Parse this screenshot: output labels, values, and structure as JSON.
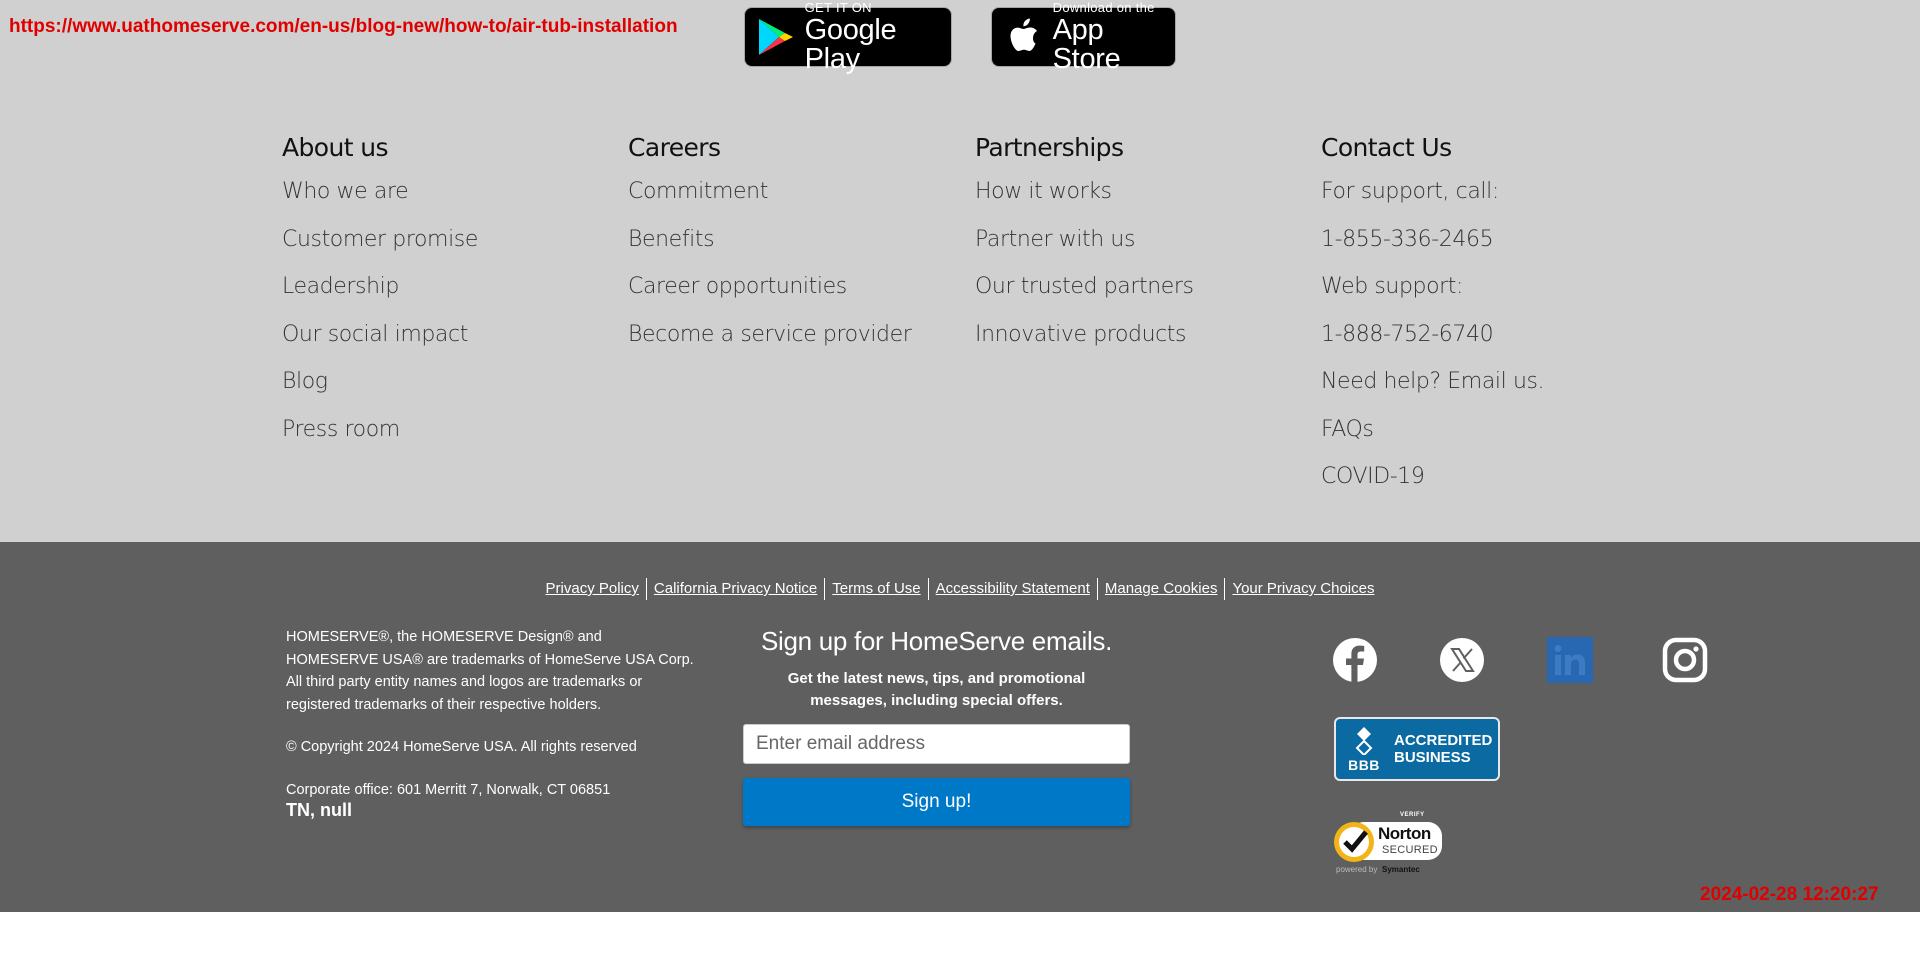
{
  "url_stamp": "https://www.uathomeserve.com/en-us/blog-new/how-to/air-tub-installation",
  "badges": {
    "google": {
      "small": "GET IT ON",
      "big": "Google Play"
    },
    "apple": {
      "small": "Download on the",
      "big": "App Store"
    }
  },
  "columns": {
    "about": {
      "title": "About us",
      "links": [
        "Who we are",
        "Customer promise",
        "Leadership",
        "Our social impact",
        "Blog",
        "Press room"
      ]
    },
    "careers": {
      "title": "Careers",
      "links": [
        "Commitment",
        "Benefits",
        "Career opportunities",
        "Become a service provider"
      ]
    },
    "partnerships": {
      "title": "Partnerships",
      "links": [
        "How it works",
        "Partner with us",
        "Our trusted partners",
        "Innovative products"
      ]
    },
    "contact": {
      "title": "Contact Us",
      "links": [
        "For support, call:",
        "1-855-336-2465",
        "Web support:",
        "1-888-752-6740",
        "Need help? Email us.",
        "FAQs",
        "COVID-19"
      ]
    }
  },
  "legal_links": [
    "Privacy Policy",
    "California Privacy Notice",
    "Terms of Use",
    "Accessibility Statement",
    "Manage Cookies",
    "Your Privacy Choices"
  ],
  "legal": {
    "trademark": "HOMESERVE®, the HOMESERVE Design® and HOMESERVE USA® are trademarks of HomeServe USA Corp. All third party entity names and logos are trademarks or registered trademarks of their respective holders.",
    "copyright": "© Copyright 2024 HomeServe USA. All rights reserved",
    "corporate": "Corporate office: 601 Merritt 7, Norwalk, CT 06851",
    "location": "TN, null"
  },
  "signup": {
    "title": "Sign up for HomeServe emails.",
    "subtitle": "Get the latest news, tips, and promotional messages, including special offers.",
    "placeholder": "Enter email address",
    "button": "Sign up!"
  },
  "bbb": {
    "logo_text": "BBB",
    "line1": "ACCREDITED",
    "line2": "BUSINESS"
  },
  "norton": {
    "verify": "VERIFY",
    "name": "Norton",
    "secured": "SECURED",
    "powered": "powered by",
    "symantec": "Symantec"
  },
  "timestamp": "2024-02-28 12:20:27",
  "colors": {
    "top_bg": "#d0d0d0",
    "bottom_bg": "#5f5f5f",
    "signup_button": "#0078c8",
    "stamp": "#e00000",
    "linkedin": "#2867b2",
    "bbb": "#0a6aa1"
  }
}
